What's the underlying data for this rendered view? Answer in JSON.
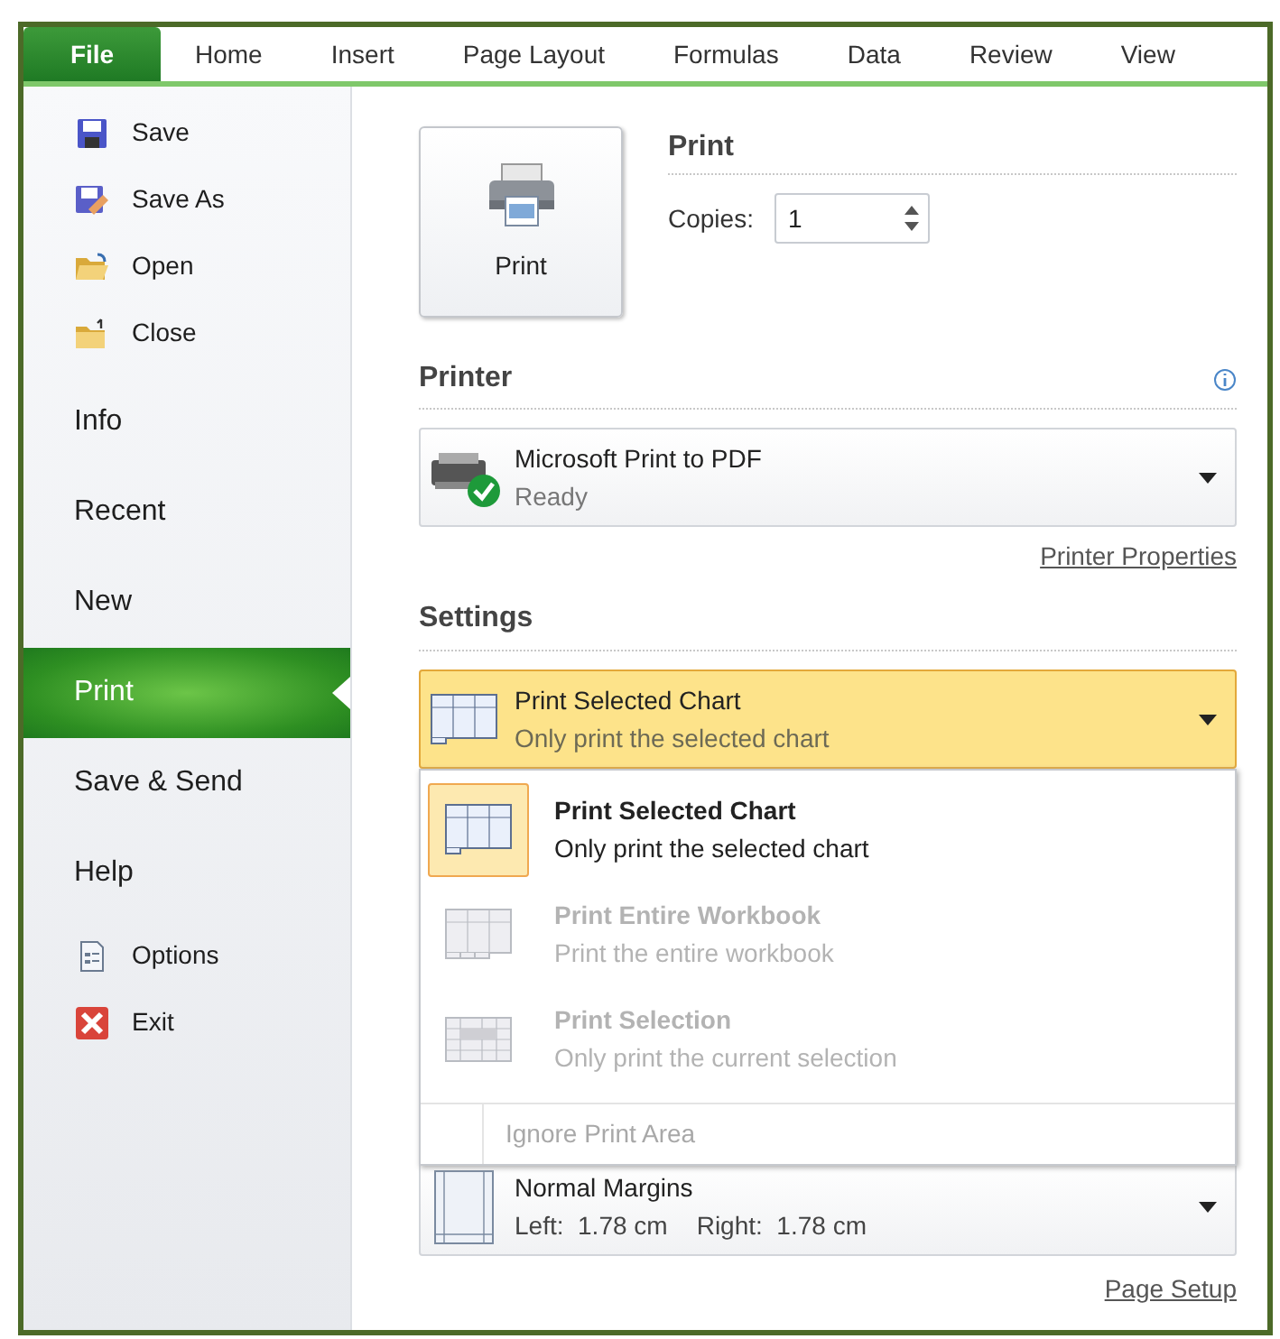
{
  "tabs": [
    {
      "label": "File",
      "selected": true
    },
    {
      "label": "Home",
      "selected": false
    },
    {
      "label": "Insert",
      "selected": false
    },
    {
      "label": "Page Layout",
      "selected": false
    },
    {
      "label": "Formulas",
      "selected": false
    },
    {
      "label": "Data",
      "selected": false
    },
    {
      "label": "Review",
      "selected": false
    },
    {
      "label": "View",
      "selected": false
    }
  ],
  "sidebar": {
    "items": [
      {
        "label": "Save",
        "kind": "command",
        "selected": false
      },
      {
        "label": "Save As",
        "kind": "command",
        "selected": false
      },
      {
        "label": "Open",
        "kind": "command",
        "selected": false
      },
      {
        "label": "Close",
        "kind": "command",
        "selected": false
      },
      {
        "label": "Info",
        "kind": "page",
        "selected": false
      },
      {
        "label": "Recent",
        "kind": "page",
        "selected": false
      },
      {
        "label": "New",
        "kind": "page",
        "selected": false
      },
      {
        "label": "Print",
        "kind": "page",
        "selected": true
      },
      {
        "label": "Save & Send",
        "kind": "page",
        "selected": false
      },
      {
        "label": "Help",
        "kind": "page",
        "selected": false
      },
      {
        "label": "Options",
        "kind": "command",
        "selected": false
      },
      {
        "label": "Exit",
        "kind": "command",
        "selected": false
      }
    ]
  },
  "print": {
    "button_label": "Print",
    "heading": "Print",
    "copies_label": "Copies:",
    "copies_value": "1"
  },
  "printer": {
    "heading": "Printer",
    "name": "Microsoft Print to PDF",
    "status": "Ready",
    "properties_link": "Printer Properties"
  },
  "settings": {
    "heading": "Settings",
    "current": {
      "title": "Print Selected Chart",
      "subtitle": "Only print the selected chart",
      "expanded": true
    },
    "options": [
      {
        "title": "Print Selected Chart",
        "subtitle": "Only print the selected chart",
        "selected": true,
        "disabled": false
      },
      {
        "title": "Print Entire Workbook",
        "subtitle": "Print the entire workbook",
        "selected": false,
        "disabled": true
      },
      {
        "title": "Print Selection",
        "subtitle": "Only print the current selection",
        "selected": false,
        "disabled": true
      }
    ],
    "ignore_print_area": {
      "label": "Ignore Print Area",
      "disabled": true
    },
    "margins": {
      "title": "Normal Margins",
      "left": "Left:  1.78 cm",
      "right": "Right:  1.78 cm"
    },
    "page_setup_link": "Page Setup"
  }
}
